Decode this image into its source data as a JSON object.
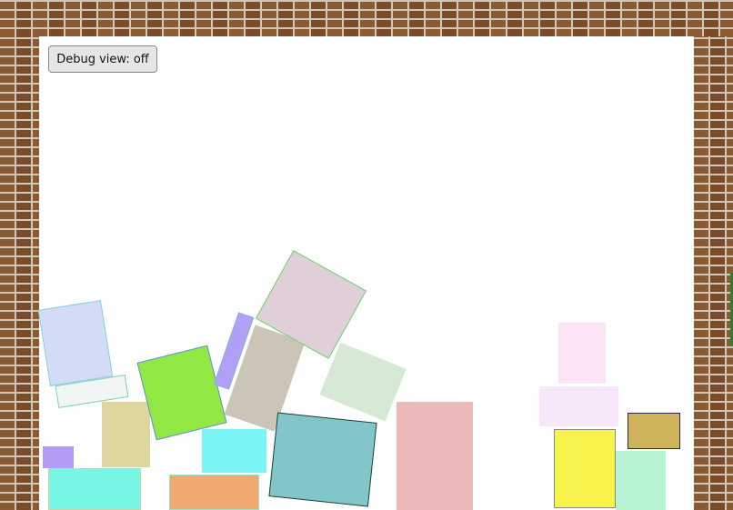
{
  "controls": {
    "debug_button_label": "Debug view: off"
  },
  "scene": {
    "wall_texture": "brick",
    "background_color": "#ffffff",
    "block_count": 21
  }
}
